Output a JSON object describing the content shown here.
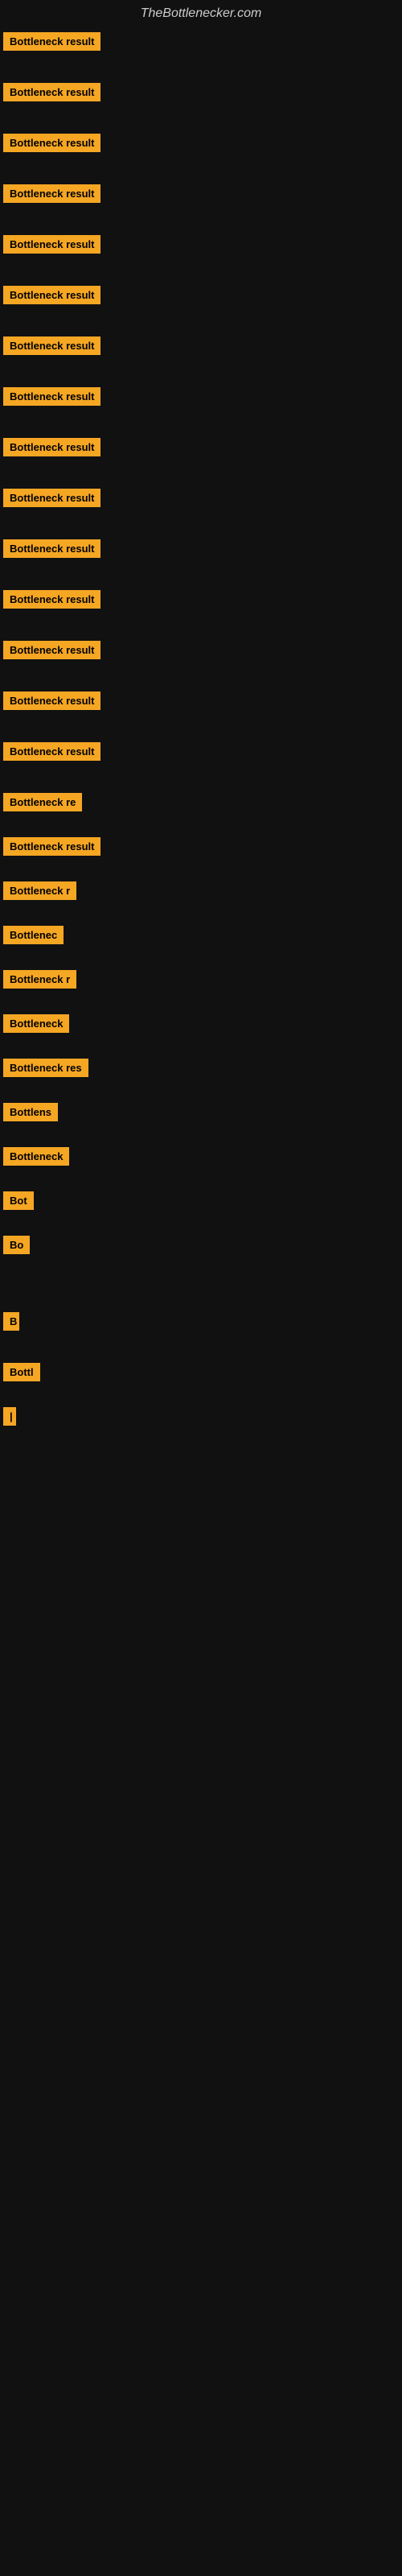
{
  "site": {
    "title": "TheBottlenecker.com"
  },
  "items": [
    {
      "label": "Bottleneck result",
      "width_class": "w-full",
      "spacing": "row"
    },
    {
      "label": "Bottleneck result",
      "width_class": "w-full",
      "spacing": "row"
    },
    {
      "label": "Bottleneck result",
      "width_class": "w-full",
      "spacing": "row"
    },
    {
      "label": "Bottleneck result",
      "width_class": "w-full",
      "spacing": "row"
    },
    {
      "label": "Bottleneck result",
      "width_class": "w-full",
      "spacing": "row"
    },
    {
      "label": "Bottleneck result",
      "width_class": "w-full",
      "spacing": "row"
    },
    {
      "label": "Bottleneck result",
      "width_class": "w-full",
      "spacing": "row"
    },
    {
      "label": "Bottleneck result",
      "width_class": "w-full",
      "spacing": "row"
    },
    {
      "label": "Bottleneck result",
      "width_class": "w-full",
      "spacing": "row"
    },
    {
      "label": "Bottleneck result",
      "width_class": "w-full",
      "spacing": "row"
    },
    {
      "label": "Bottleneck result",
      "width_class": "w-full",
      "spacing": "row"
    },
    {
      "label": "Bottleneck result",
      "width_class": "w-full",
      "spacing": "row"
    },
    {
      "label": "Bottleneck result",
      "width_class": "w-full",
      "spacing": "row"
    },
    {
      "label": "Bottleneck result",
      "width_class": "w-full",
      "spacing": "row"
    },
    {
      "label": "Bottleneck result",
      "width_class": "w-full",
      "spacing": "row"
    },
    {
      "label": "Bottleneck re",
      "width_class": "w-lg",
      "spacing": "row-sm"
    },
    {
      "label": "Bottleneck result",
      "width_class": "w-lg",
      "spacing": "row-sm"
    },
    {
      "label": "Bottleneck r",
      "width_class": "w-md",
      "spacing": "row-sm"
    },
    {
      "label": "Bottlenec",
      "width_class": "w-sm2",
      "spacing": "row-sm"
    },
    {
      "label": "Bottleneck r",
      "width_class": "w-sm",
      "spacing": "row-sm"
    },
    {
      "label": "Bottleneck",
      "width_class": "w-sm",
      "spacing": "row-sm"
    },
    {
      "label": "Bottleneck res",
      "width_class": "w-xs2",
      "spacing": "row-sm"
    },
    {
      "label": "Bottlens",
      "width_class": "w-xs2",
      "spacing": "row-sm"
    },
    {
      "label": "Bottleneck",
      "width_class": "w-xs",
      "spacing": "row-sm"
    },
    {
      "label": "Bot",
      "width_class": "w-xxs",
      "spacing": "row-sm"
    },
    {
      "label": "Bo",
      "width_class": "w-3xs",
      "spacing": "row-sm"
    },
    {
      "label": "",
      "width_class": "w-4xs",
      "spacing": "row"
    },
    {
      "label": "B",
      "width_class": "w-5xs",
      "spacing": "row"
    },
    {
      "label": "Bottl",
      "width_class": "w-xxs",
      "spacing": "row-sm"
    },
    {
      "label": "|",
      "width_class": "w-6xs",
      "spacing": "row"
    }
  ],
  "colors": {
    "background": "#111111",
    "badge_bg": "#f5a623",
    "badge_text": "#000000",
    "title_text": "#cccccc"
  }
}
